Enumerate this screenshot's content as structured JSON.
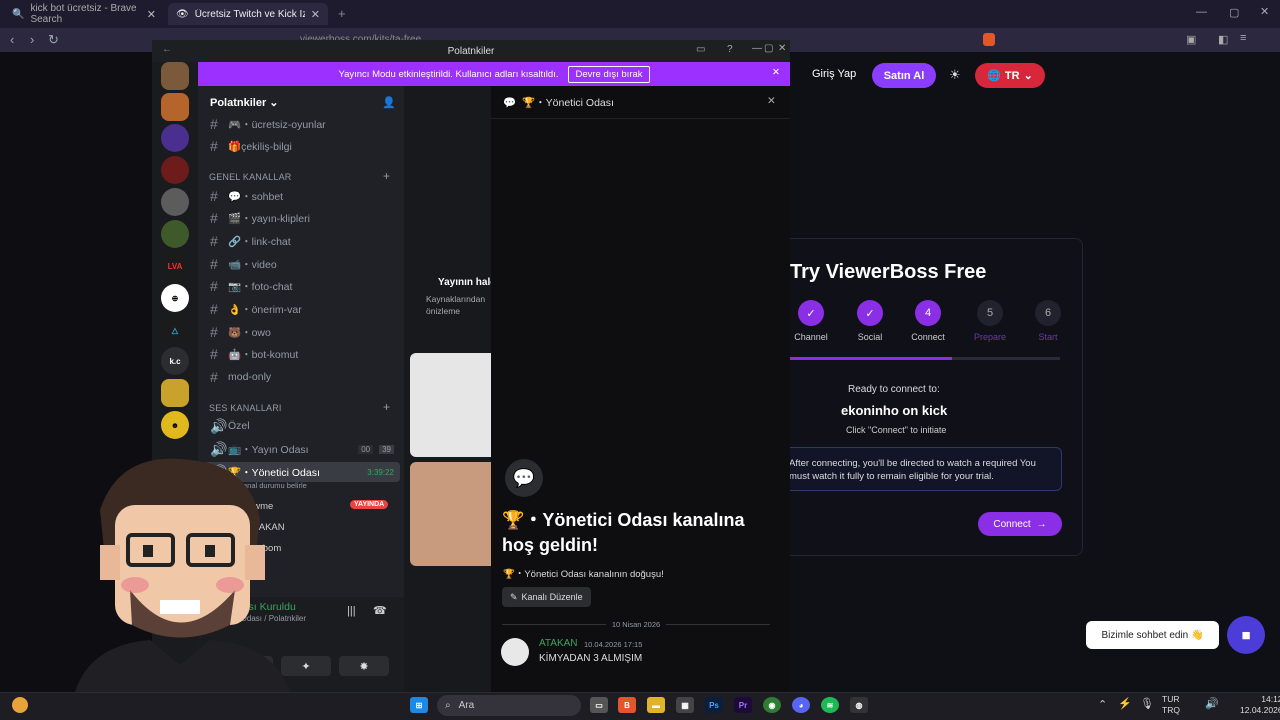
{
  "browser": {
    "tabs": [
      {
        "label": "kick bot ücretsiz - Brave Search",
        "active": false
      },
      {
        "label": "Ücretsiz Twitch ve Kick İzleyiciler",
        "active": true
      }
    ],
    "url": "viewerboss.com/kits/ta-free"
  },
  "site": {
    "login": "Giriş Yap",
    "buy": "Satın Al",
    "lang": "TR",
    "card_title": "Try ViewerBoss Free",
    "steps": [
      {
        "label": "Channel",
        "done": true
      },
      {
        "label": "Social",
        "done": true
      },
      {
        "label": "Connect",
        "num": "4",
        "done": true
      },
      {
        "label": "Prepare",
        "num": "5",
        "done": false
      },
      {
        "label": "Start",
        "num": "6",
        "done": false
      }
    ],
    "progress": 0.6,
    "ready": "Ready to connect to:",
    "target": "ekoninho on kick",
    "hint": "Click \"Connect\" to initiate",
    "info": "After connecting, you'll be directed to watch a required You must watch it fully to remain eligible for your trial.",
    "connect": "Connect",
    "chat_bubble": "Bizimle sohbet edin 👋"
  },
  "discord": {
    "window_title": "Polatnkiler",
    "banner_text": "Yayıncı Modu etkinleştirildi. Kullanıcı adları kısaltıldı.",
    "banner_btn": "Devre dışı bırak",
    "server_name": "Polatnkiler",
    "channels_top": [
      {
        "name": "🎮・ücretsiz-oyunlar"
      },
      {
        "name": "🎁çekiliş-bilgi"
      }
    ],
    "category_general": "GENEL KANALLAR",
    "channels_general": [
      {
        "name": "💬・sohbet"
      },
      {
        "name": "🎬・yayın-klipleri"
      },
      {
        "name": "🔗・link-chat"
      },
      {
        "name": "📹・video"
      },
      {
        "name": "📷・foto-chat"
      },
      {
        "name": "👌・önerim-var"
      },
      {
        "name": "🐻・owo"
      },
      {
        "name": "🤖・bot-komut"
      },
      {
        "name": "mod-only"
      }
    ],
    "category_voice": "SES KANALLARI",
    "voice_channels": [
      {
        "name": "Özel"
      },
      {
        "name": "📺・Yayın Odası",
        "badge1": "00",
        "badge2": "39"
      },
      {
        "name": "🏆・Yönetici Odası",
        "timer": "3:39:22"
      }
    ],
    "voice_status_hint": "Bir kanal durumu belirle",
    "voice_users": [
      "ewme",
      "ATAKAN",
      "cimbom"
    ],
    "live_label": "YAYINDA",
    "connected": "Bağlantısı Kuruldu",
    "connected_sub": "Yönetici Odası / Polatnkiler",
    "mid_title": "Yayının hale",
    "mid_sub": "Kaynaklarından önizleme",
    "thread_title": "🏆・Yönetici Odası",
    "welcome": "🏆・Yönetici Odası kanalına hoş geldin!",
    "welcome_sub": "🏆・Yönetici Odası kanalının doğuşu!",
    "edit_channel": "Kanalı Düzenle",
    "date": "10 Nisan 2026",
    "message": {
      "author": "ATAKAN",
      "time": "10.04.2026 17:15",
      "text": "KİMYADAN 3 ALMIŞIM"
    }
  },
  "taskbar": {
    "search": "Ara",
    "lang_top": "TUR",
    "lang_bottom": "TRQ",
    "time": "14:12",
    "date": "12.04.2026"
  },
  "colors": {
    "accent": "#8b2fe6",
    "banner": "#9b30ff",
    "live": "#ed4245",
    "discord_bg": "#1e1f22"
  }
}
